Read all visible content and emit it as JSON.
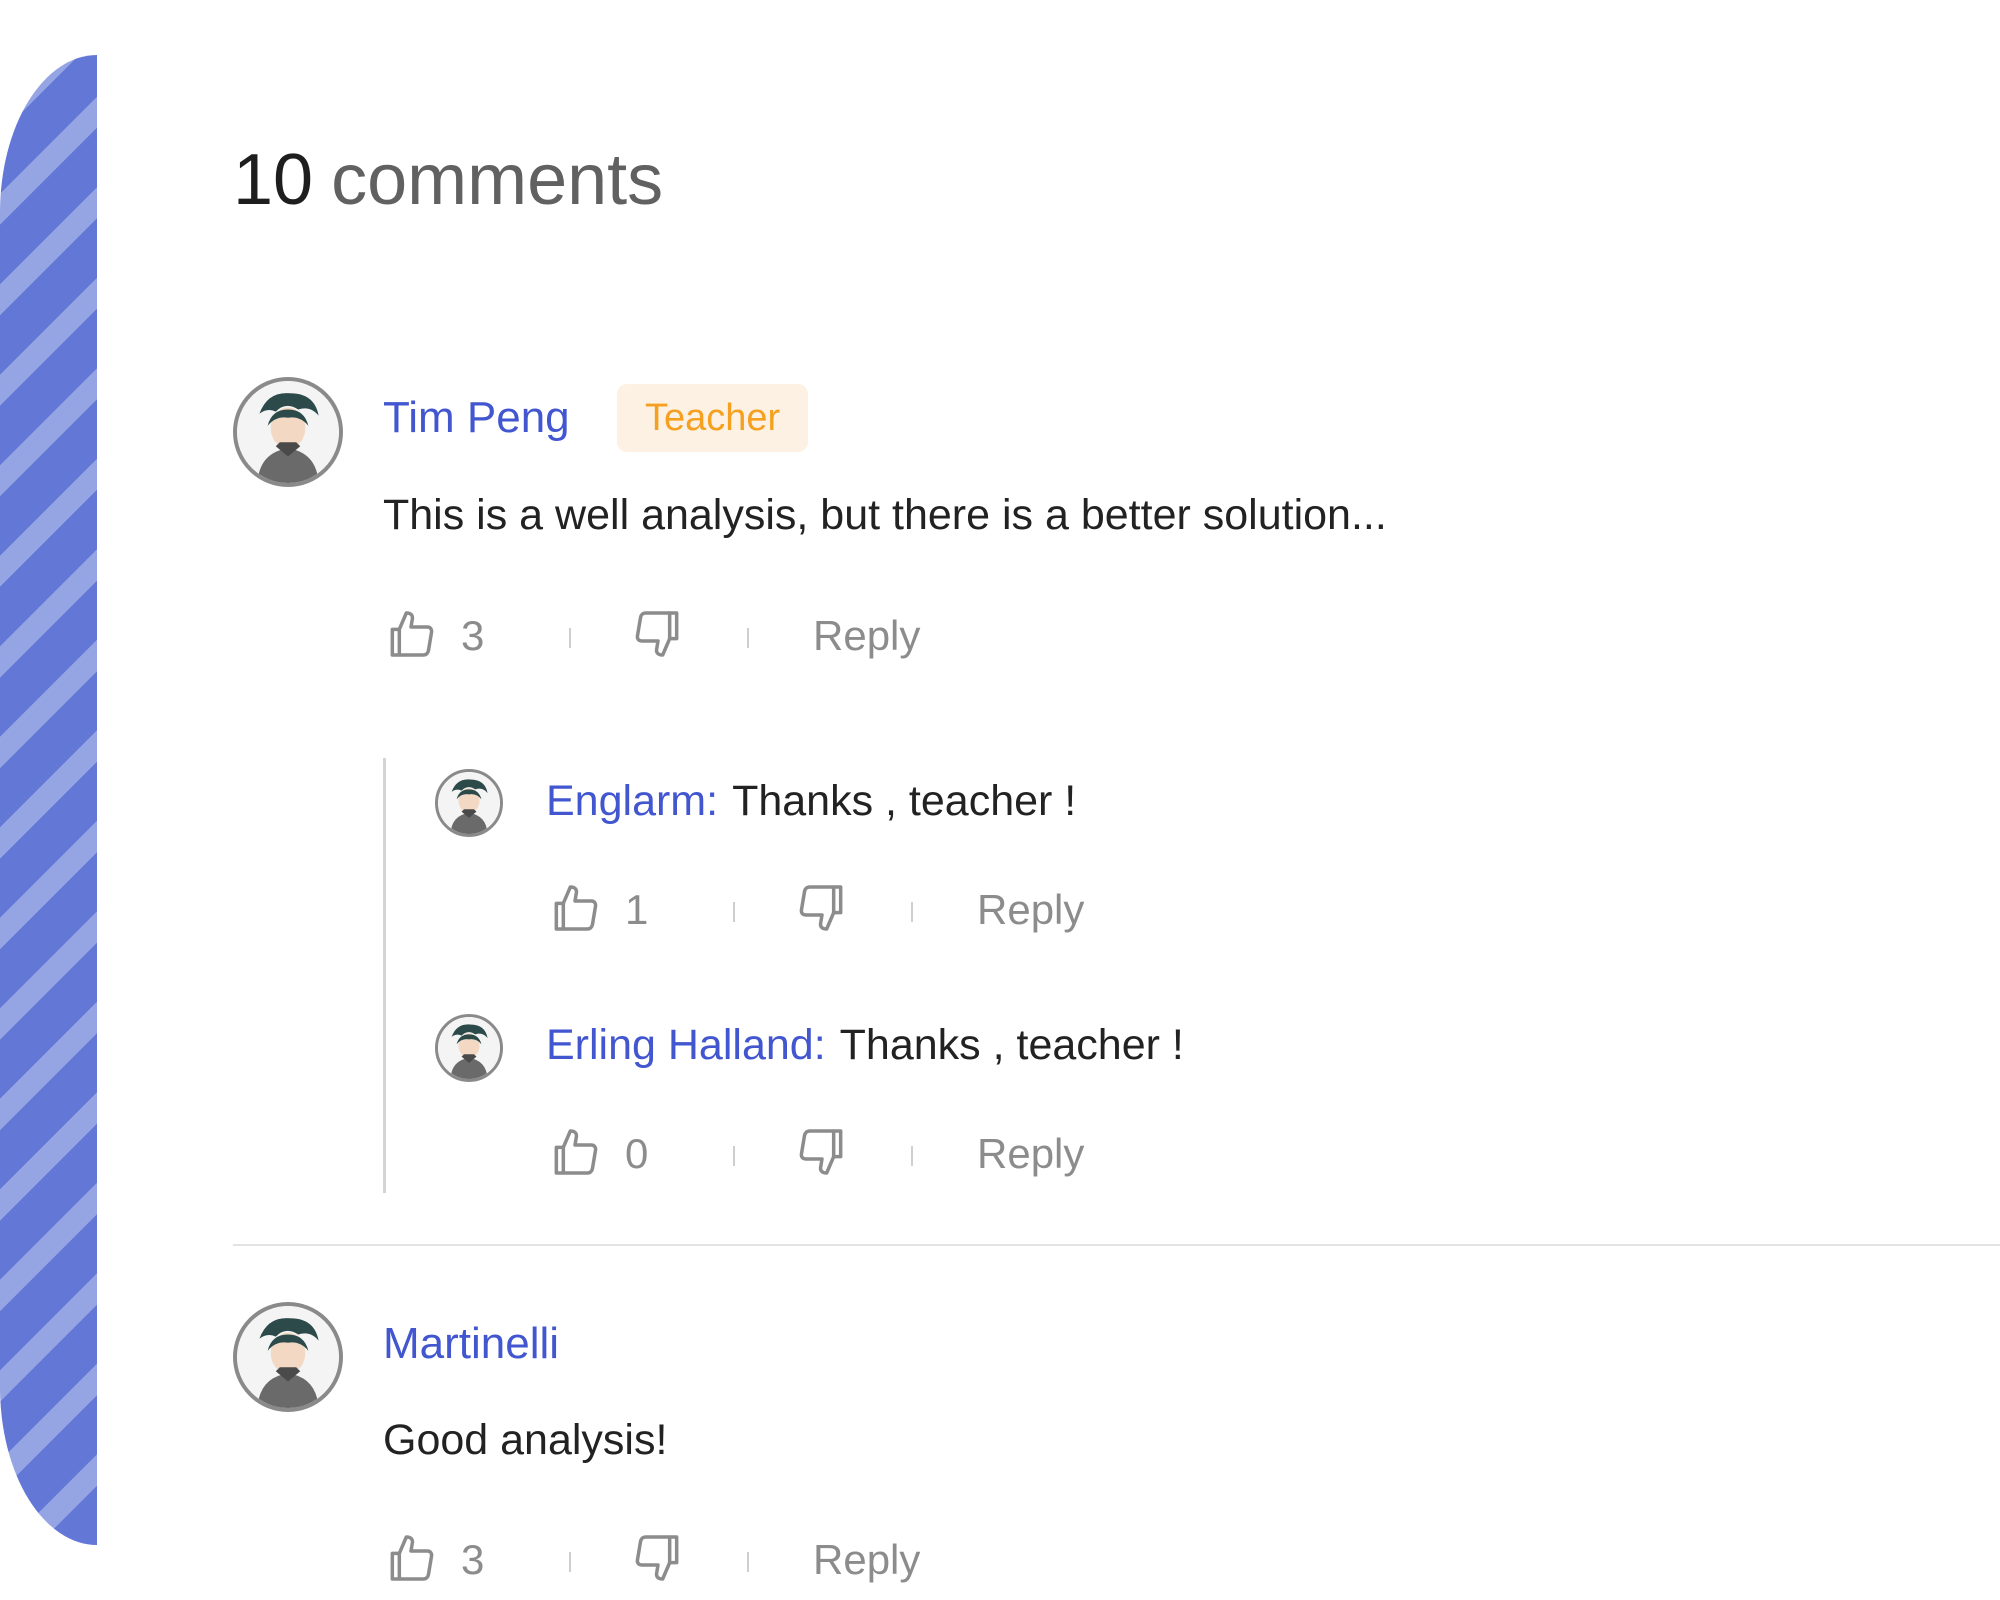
{
  "header": {
    "count": "10",
    "label": "comments"
  },
  "comments": [
    {
      "author": "Tim Peng",
      "badge": "Teacher",
      "text": "This is a well analysis, but there is a better solution...",
      "likes": "3",
      "reply_label": "Reply",
      "replies": [
        {
          "author": "Englarm:",
          "text": "Thanks , teacher !",
          "likes": "1",
          "reply_label": "Reply"
        },
        {
          "author": "Erling Halland:",
          "text": "Thanks , teacher !",
          "likes": "0",
          "reply_label": "Reply"
        }
      ]
    },
    {
      "author": "Martinelli",
      "text": "Good analysis!",
      "likes": "3",
      "reply_label": "Reply"
    }
  ],
  "icons": {
    "like": "thumbs-up-icon",
    "dislike": "thumbs-down-icon",
    "avatar": "user-avatar"
  },
  "colors": {
    "author": "#4256cf",
    "badge_text": "#f5a020",
    "badge_bg": "#fdf1e3",
    "muted": "#8c8c8c",
    "decor_dark": "#6277d6",
    "decor_light": "#95a4e3"
  }
}
